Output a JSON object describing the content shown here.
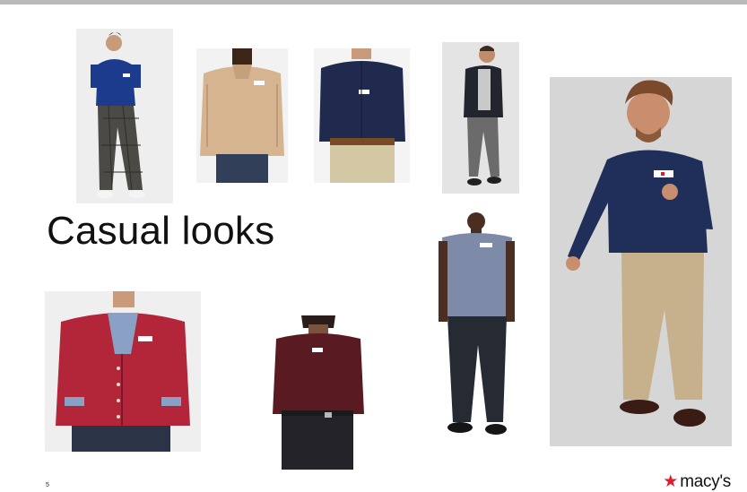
{
  "slide": {
    "title": "Casual looks",
    "page_number": "5"
  },
  "brand": {
    "name": "macy's",
    "accent_color": "#e21a2c"
  },
  "photos": [
    {
      "id": "polo-blue-plaid-pants",
      "shirt_color": "#1d3b8c",
      "pants_color": "#4c4a45"
    },
    {
      "id": "quarter-zip-sweater-tan",
      "shirt_color": "#d6b490",
      "pants_color": "#314058"
    },
    {
      "id": "navy-dress-shirt-khakis",
      "shirt_color": "#1f2a4e",
      "pants_color": "#d4c7a3"
    },
    {
      "id": "black-jacket-gray-pants",
      "shirt_color": "#22252d",
      "pants_color": "#6b6b6b"
    },
    {
      "id": "navy-sweater-khaki-chinos",
      "shirt_color": "#1f2f5a",
      "pants_color": "#c7b08c"
    },
    {
      "id": "red-cardigan",
      "shirt_color": "#b3263a",
      "pants_color": "#2b3447"
    },
    {
      "id": "maroon-polo-black-jeans",
      "shirt_color": "#5a1a22",
      "pants_color": "#24232a"
    },
    {
      "id": "gray-polo-black-pants",
      "shirt_color": "#7d8aa8",
      "pants_color": "#262a33"
    }
  ]
}
